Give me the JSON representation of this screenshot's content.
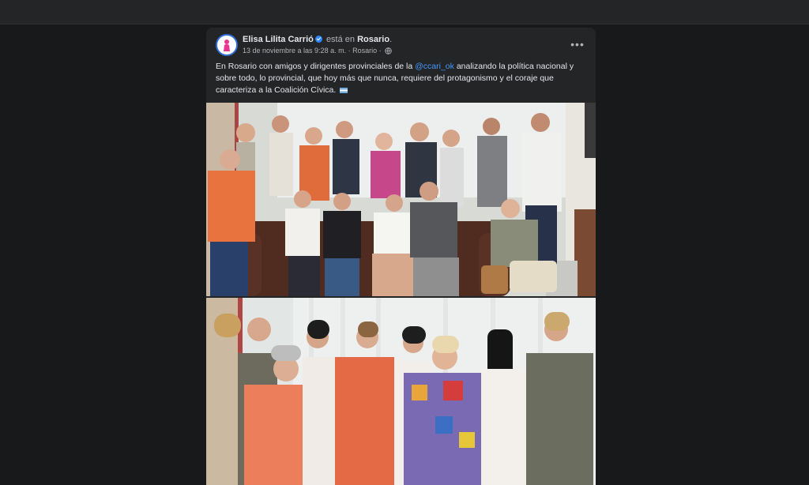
{
  "post": {
    "author": "Elisa Lilita Carrió",
    "is_at": "está en",
    "location": "Rosario",
    "location_suffix": ".",
    "timestamp": "13 de noviembre a las 9:28 a. m.",
    "separator": " · ",
    "place_meta": "Rosario",
    "text_before_mention": "En Rosario con amigos y dirigentes provinciales de la ",
    "mention": "@ccari_ok",
    "text_after_mention": " analizando la política nacional y sobre todo, lo provincial, que hoy más que nunca, requiere del protagonismo y el coraje que caracteriza a la Coalición Cívica.",
    "more_label": "•••"
  },
  "photos": {
    "photo1_icon": "group-photo-sofa",
    "photo2_icon": "group-photo-women"
  },
  "colors": {
    "background": "#18191a",
    "card": "#242526",
    "mention": "#4599ff",
    "verified": "#2d88ff"
  }
}
